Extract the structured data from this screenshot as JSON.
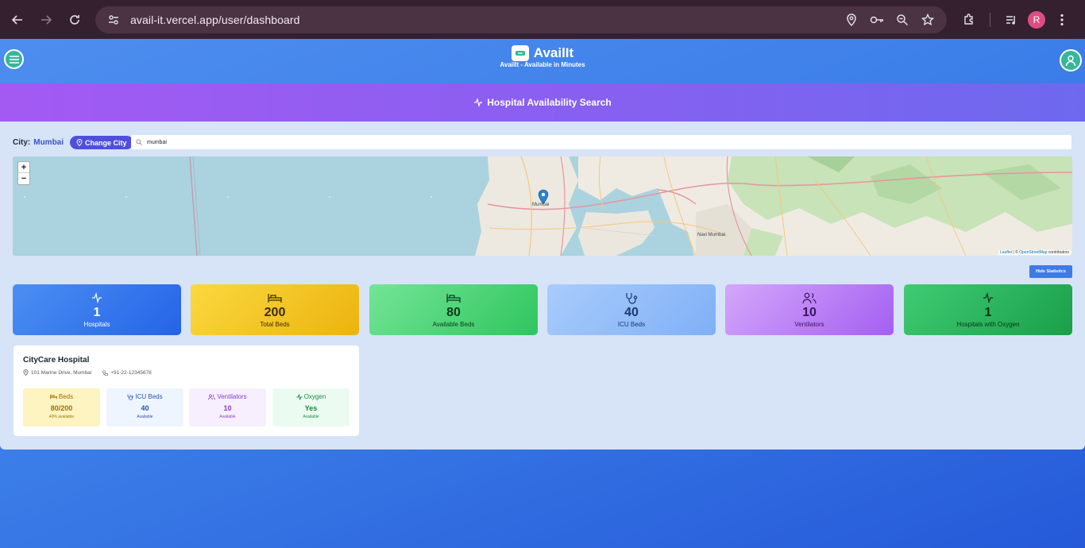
{
  "browser": {
    "url": "avail-it.vercel.app/user/dashboard",
    "profile_initial": "R"
  },
  "app": {
    "name": "AvailIt",
    "tagline": "AvailIt - Available in Minutes"
  },
  "banner": {
    "title": "Hospital Availability Search"
  },
  "city": {
    "label": "City:",
    "value": "Mumbai",
    "change_label": "Change City"
  },
  "search": {
    "value": "mumbai"
  },
  "map": {
    "zoom_in": "+",
    "zoom_out": "−",
    "place_mumbai": "Mumbai",
    "place_navi": "Navi Mumbai",
    "attribution_leaflet": "Leaflet",
    "attribution_sep": "| ©",
    "attribution_osm": "OpenStreetMap",
    "attribution_tail": "contributors"
  },
  "hide_stats_label": "Hide Statistics",
  "stats": [
    {
      "value": "1",
      "label": "Hospitals",
      "icon": "activity-icon"
    },
    {
      "value": "200",
      "label": "Total Beds",
      "icon": "bed-icon"
    },
    {
      "value": "80",
      "label": "Available Beds",
      "icon": "bed-icon"
    },
    {
      "value": "40",
      "label": "ICU Beds",
      "icon": "stethoscope-icon"
    },
    {
      "value": "10",
      "label": "Ventilators",
      "icon": "users-icon"
    },
    {
      "value": "1",
      "label": "Hospitals with Oxygen",
      "icon": "activity-icon"
    }
  ],
  "hospital": {
    "name": "CityCare Hospital",
    "address": "101 Marine Drive, Mumbai",
    "phone": "+91-22-12345678",
    "boxes": [
      {
        "title": "Beds",
        "value": "80/200",
        "sub": "40% available"
      },
      {
        "title": "ICU Beds",
        "value": "40",
        "sub": "Available"
      },
      {
        "title": "Ventilators",
        "value": "10",
        "sub": "Available"
      },
      {
        "title": "Oxygen",
        "value": "Yes",
        "sub": "Available"
      }
    ]
  },
  "colors": {
    "accent": "#4f4fdc",
    "banner_start": "#a35af3",
    "banner_end": "#6d69ee",
    "header_teal": "#36b69b"
  }
}
